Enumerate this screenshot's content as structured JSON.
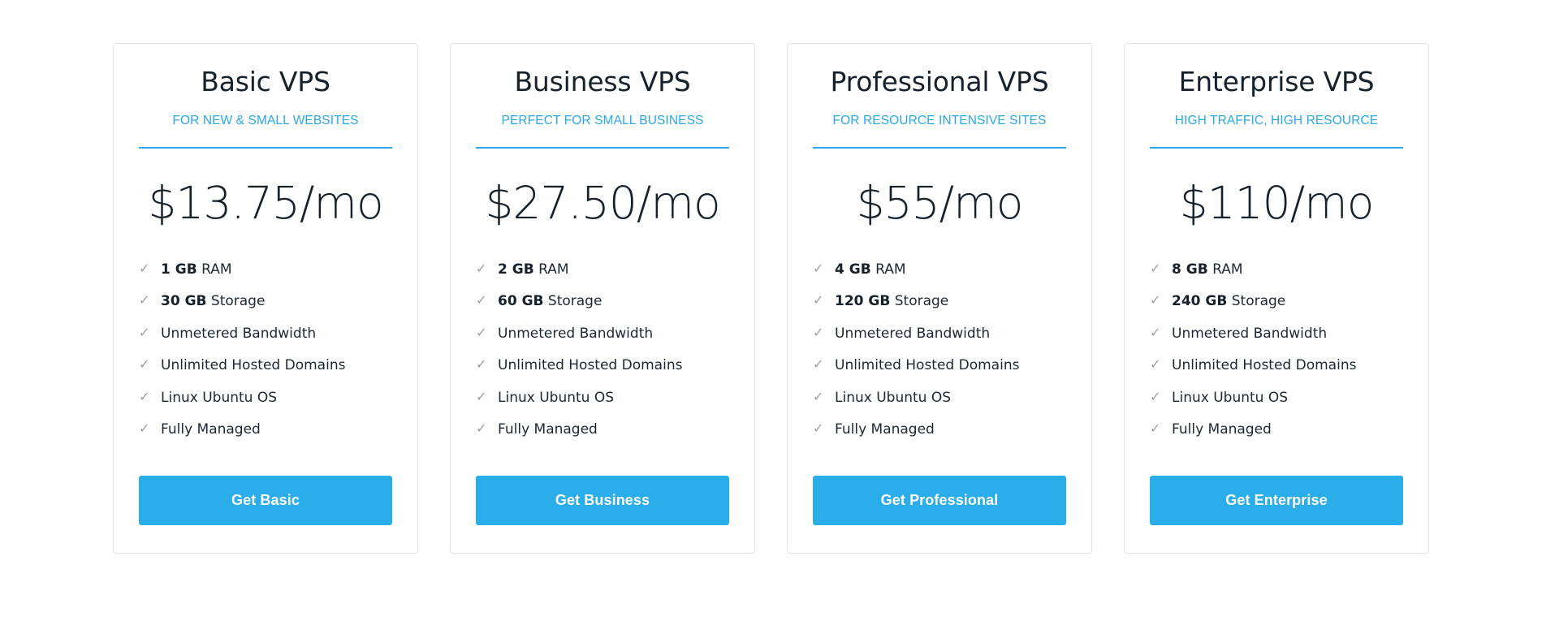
{
  "theme": {
    "accent": "#2ba7e8",
    "button_bg": "#2badea",
    "title_color": "#16212c",
    "card_border": "#e3e3e3",
    "check_color": "#9aa0a6"
  },
  "icons": {
    "check": "check-icon"
  },
  "plans": [
    {
      "title": "Basic VPS",
      "subtitle": "FOR NEW & SMALL WEBSITES",
      "price": "$13.75/mo",
      "features": [
        {
          "strong": "1 GB",
          "rest": " RAM"
        },
        {
          "strong": "30 GB",
          "rest": " Storage"
        },
        {
          "strong": "",
          "rest": "Unmetered Bandwidth"
        },
        {
          "strong": "",
          "rest": "Unlimited Hosted Domains"
        },
        {
          "strong": "",
          "rest": "Linux Ubuntu OS"
        },
        {
          "strong": "",
          "rest": "Fully Managed"
        }
      ],
      "cta": "Get Basic"
    },
    {
      "title": "Business VPS",
      "subtitle": "PERFECT FOR SMALL BUSINESS",
      "price": "$27.50/mo",
      "features": [
        {
          "strong": "2 GB",
          "rest": " RAM"
        },
        {
          "strong": "60 GB",
          "rest": " Storage"
        },
        {
          "strong": "",
          "rest": "Unmetered Bandwidth"
        },
        {
          "strong": "",
          "rest": "Unlimited Hosted Domains"
        },
        {
          "strong": "",
          "rest": "Linux Ubuntu OS"
        },
        {
          "strong": "",
          "rest": "Fully Managed"
        }
      ],
      "cta": "Get Business"
    },
    {
      "title": "Professional VPS",
      "subtitle": "FOR RESOURCE INTENSIVE SITES",
      "price": "$55/mo",
      "features": [
        {
          "strong": "4 GB",
          "rest": " RAM"
        },
        {
          "strong": "120 GB",
          "rest": " Storage"
        },
        {
          "strong": "",
          "rest": "Unmetered Bandwidth"
        },
        {
          "strong": "",
          "rest": "Unlimited Hosted Domains"
        },
        {
          "strong": "",
          "rest": "Linux Ubuntu OS"
        },
        {
          "strong": "",
          "rest": "Fully Managed"
        }
      ],
      "cta": "Get Professional"
    },
    {
      "title": "Enterprise VPS",
      "subtitle": "HIGH TRAFFIC, HIGH RESOURCE",
      "price": "$110/mo",
      "features": [
        {
          "strong": "8 GB",
          "rest": " RAM"
        },
        {
          "strong": "240 GB",
          "rest": " Storage"
        },
        {
          "strong": "",
          "rest": "Unmetered Bandwidth"
        },
        {
          "strong": "",
          "rest": "Unlimited Hosted Domains"
        },
        {
          "strong": "",
          "rest": "Linux Ubuntu OS"
        },
        {
          "strong": "",
          "rest": "Fully Managed"
        }
      ],
      "cta": "Get Enterprise"
    }
  ]
}
